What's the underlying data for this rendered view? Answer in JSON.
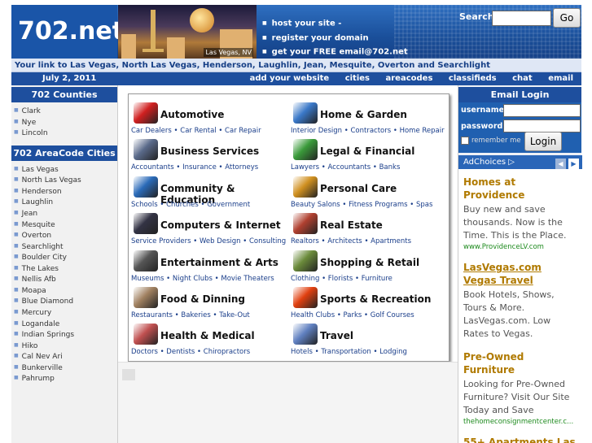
{
  "header": {
    "logo": "702.net",
    "photo_caption": "Las Vegas, NV",
    "promo": [
      "host your site -",
      "register your domain",
      "get your FREE email@702.net"
    ],
    "search_label": "Search",
    "search_value": "",
    "go_label": "Go"
  },
  "tagline": "Your link to Las Vegas, North Las Vegas, Henderson, Laughlin, Jean, Mesquite, Overton and Searchlight",
  "navbar": {
    "date": "July 2, 2011",
    "links": [
      "add your website",
      "cities",
      "areacodes",
      "classifieds",
      "chat",
      "email"
    ]
  },
  "counties": {
    "title": "702 Counties",
    "items": [
      "Clark",
      "Nye",
      "Lincoln"
    ]
  },
  "cities": {
    "title": "702 AreaCode Cities",
    "items": [
      "Las Vegas",
      "North Las Vegas",
      "Henderson",
      "Laughlin",
      "Jean",
      "Mesquite",
      "Overton",
      "Searchlight",
      "Boulder City",
      "The Lakes",
      "Nellis Afb",
      "Moapa",
      "Blue Diamond",
      "Mercury",
      "Logandale",
      "Indian Springs",
      "Hiko",
      "Cal Nev Ari",
      "Bunkerville",
      "Pahrump"
    ]
  },
  "categories": [
    {
      "title": "Automotive",
      "subs": "Car Dealers • Car Rental • Car Repair",
      "icon": "car-icon",
      "color": "#d02020"
    },
    {
      "title": "Home & Garden",
      "subs": "Interior Design • Contractors • Home Repair",
      "icon": "house-icon",
      "color": "#3a78c8"
    },
    {
      "title": "Business Services",
      "subs": "Accountants • Insurance • Attorneys",
      "icon": "office-building-icon",
      "color": "#5a6a8a"
    },
    {
      "title": "Legal & Financial",
      "subs": "Lawyers • Accountants • Banks",
      "icon": "money-icon",
      "color": "#3a9a3a"
    },
    {
      "title": "Community & Education",
      "subs": "Schools • Churches • Government",
      "icon": "umbrella-icon",
      "color": "#2a6ab8"
    },
    {
      "title": "Personal Care",
      "subs": "Beauty Salons • Fitness Programs • Spas",
      "icon": "people-icon",
      "color": "#d09020"
    },
    {
      "title": "Computers & Internet",
      "subs": "Service Providers • Web Design • Consulting",
      "icon": "laptop-icon",
      "color": "#333344"
    },
    {
      "title": "Real Estate",
      "subs": "Realtors • Architects • Apartments",
      "icon": "buildings-icon",
      "color": "#b04030"
    },
    {
      "title": "Entertainment & Arts",
      "subs": "Museums • Night Clubs • Movie Theaters",
      "icon": "film-reel-icon",
      "color": "#555555"
    },
    {
      "title": "Shopping & Retail",
      "subs": "Clothing • Florists • Furniture",
      "icon": "shopping-cart-icon",
      "color": "#6a8a3a"
    },
    {
      "title": "Food & Dinning",
      "subs": "Restaurants • Bakeries • Take-Out",
      "icon": "coffee-cup-icon",
      "color": "#a08060"
    },
    {
      "title": "Sports & Recreation",
      "subs": "Health Clubs • Parks • Golf Courses",
      "icon": "target-icon",
      "color": "#e04010"
    },
    {
      "title": "Health & Medical",
      "subs": "Doctors • Dentists • Chiropractors",
      "icon": "doctor-icon",
      "color": "#c05050"
    },
    {
      "title": "Travel",
      "subs": "Hotels • Transportation • Lodging",
      "icon": "plane-icon",
      "color": "#6080c0"
    }
  ],
  "email": {
    "title": "Email Login",
    "username_label": "username:",
    "password_label": "password:",
    "remember_label": "remember me",
    "login_label": "Login"
  },
  "adchoices": "AdChoices ▷",
  "ads": [
    {
      "title": "Homes at Providence",
      "body": "Buy new and save thousands. Now is the Time. This is the Place.",
      "url": "www.ProvidenceLV.com",
      "underline": false
    },
    {
      "title": "LasVegas.com Vegas Travel",
      "body": "Book Hotels, Shows, Tours & More. LasVegas.com. Low Rates to Vegas.",
      "url": "",
      "underline": true
    },
    {
      "title": "Pre-Owned Furniture",
      "body": "Looking for Pre-Owned Furniture? Visit Our Site Today and Save",
      "url": "thehomeconsignmentcenter.c...",
      "underline": false
    },
    {
      "title": "55+ Apartments Las",
      "body": "",
      "url": "",
      "underline": false
    }
  ]
}
